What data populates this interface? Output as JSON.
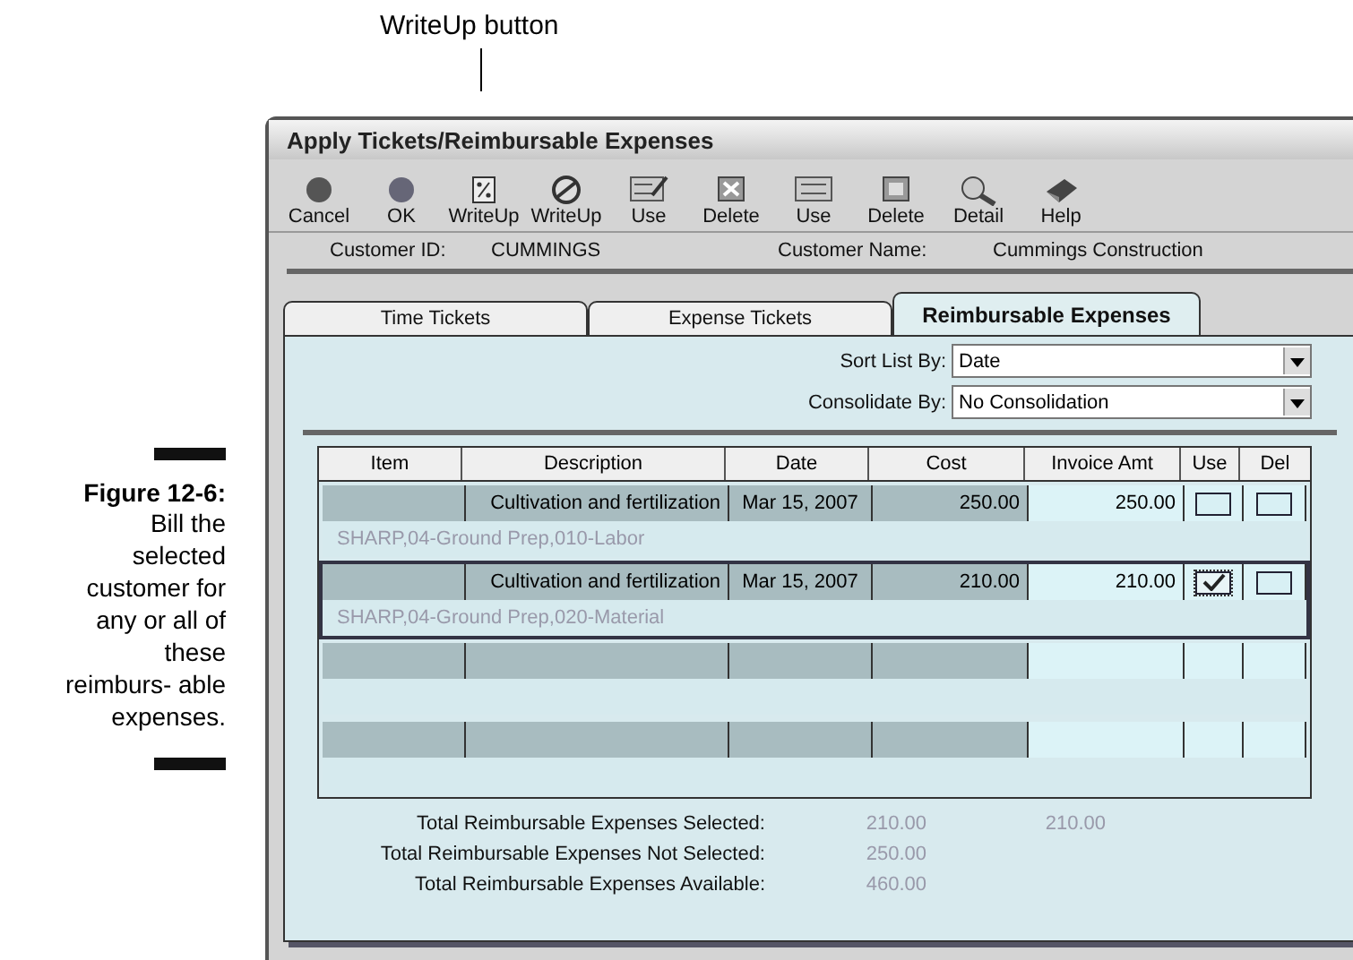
{
  "callout": {
    "label": "WriteUp button"
  },
  "caption": {
    "figure": "Figure 12-6:",
    "text": "Bill the selected customer for any or all of these reimburs- able expenses."
  },
  "window": {
    "title": "Apply Tickets/Reimbursable Expenses"
  },
  "toolbar": [
    {
      "label": "Cancel"
    },
    {
      "label": "OK"
    },
    {
      "label": "WriteUp"
    },
    {
      "label": "WriteUp"
    },
    {
      "label": "Use"
    },
    {
      "label": "Delete"
    },
    {
      "label": "Use"
    },
    {
      "label": "Delete"
    },
    {
      "label": "Detail"
    },
    {
      "label": "Help"
    }
  ],
  "customer": {
    "id_label": "Customer ID:",
    "id": "CUMMINGS",
    "name_label": "Customer Name:",
    "name": "Cummings Construction"
  },
  "tabs": [
    {
      "label": "Time Tickets",
      "selected": false
    },
    {
      "label": "Expense Tickets",
      "selected": false
    },
    {
      "label": "Reimbursable Expenses",
      "selected": true
    }
  ],
  "sort": {
    "label": "Sort List By:",
    "value": "Date"
  },
  "consolidate": {
    "label": "Consolidate By:",
    "value": "No Consolidation"
  },
  "table": {
    "columns": [
      "Item",
      "Description",
      "Date",
      "Cost",
      "Invoice Amt",
      "Use",
      "Del"
    ],
    "rows": [
      {
        "kind": "entry",
        "selected": false,
        "item": "",
        "description": "Cultivation and fertilization",
        "date": "Mar 15, 2007",
        "cost": "250.00",
        "invoice": "250.00",
        "use": false,
        "del": false,
        "account": "SHARP,04-Ground Prep,010-Labor"
      },
      {
        "kind": "entry",
        "selected": true,
        "item": "",
        "description": "Cultivation and fertilization",
        "date": "Mar 15, 2007",
        "cost": "210.00",
        "invoice": "210.00",
        "use": true,
        "del": false,
        "account": "SHARP,04-Ground Prep,020-Material"
      },
      {
        "kind": "empty"
      },
      {
        "kind": "empty"
      }
    ]
  },
  "totals": [
    {
      "label": "Total Reimbursable Expenses Selected:",
      "cost": "210.00",
      "invoice": "210.00"
    },
    {
      "label": "Total Reimbursable Expenses Not Selected:",
      "cost": "250.00"
    },
    {
      "label": "Total Reimbursable Expenses Available:",
      "cost": "460.00"
    }
  ]
}
